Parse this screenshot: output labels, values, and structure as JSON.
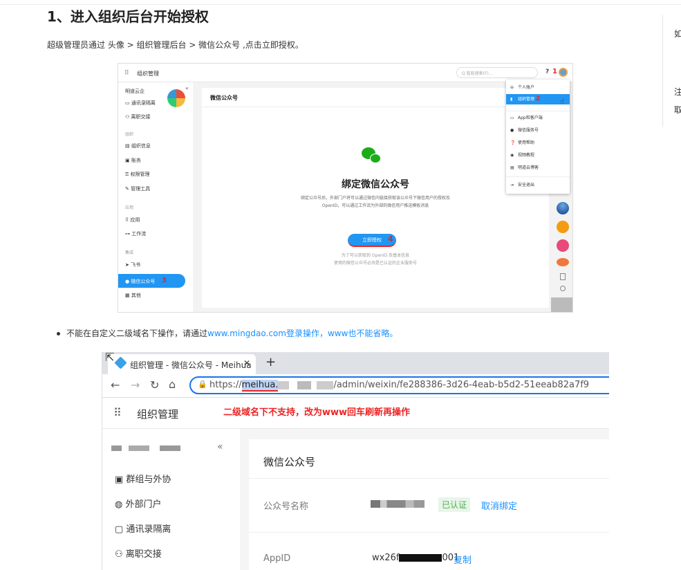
{
  "article": {
    "heading": "1、进入组织后台开始授权",
    "intro": "超级管理员通过 头像 > 组织管理后台 > 微信公众号 ,点击立即授权。",
    "right_panel": [
      "如",
      "注",
      "取"
    ]
  },
  "screenshot1": {
    "app_title": "组织管理",
    "search_placeholder": "Q 智能搜索(F)...",
    "step1": "1",
    "org_name": "明道云企",
    "sidebar": [
      {
        "label": "通讯录隔离",
        "icon": "contacts-icon"
      },
      {
        "label": "离职交接",
        "icon": "handover-icon"
      },
      {
        "group": "组织"
      },
      {
        "label": "组织信息",
        "icon": "org-info-icon"
      },
      {
        "label": "账务",
        "icon": "billing-icon"
      },
      {
        "label": "权限管理",
        "icon": "permission-icon"
      },
      {
        "label": "管理工具",
        "icon": "tools-icon"
      },
      {
        "group": "应用"
      },
      {
        "label": "应用",
        "icon": "apps-icon"
      },
      {
        "label": "工作流",
        "icon": "workflow-icon"
      },
      {
        "group": "集成"
      },
      {
        "label": "飞书",
        "icon": "feishu-icon"
      },
      {
        "label": "微信公众号",
        "icon": "wechat-icon",
        "active": true
      },
      {
        "label": "其他",
        "icon": "other-icon"
      }
    ],
    "step3": "3",
    "panel_title": "微信公众号",
    "bind_title": "绑定微信公众号",
    "bind_desc1": "绑定公众号后，外部门户将可以通过微信内链接获取该公众号下微信用户的授权及",
    "bind_desc2": "OpenID，可以通过工作流为外部的微信用户推送模板消息",
    "authorize_button": "立即授权",
    "step4": "4",
    "note1": "为了可以获取到 OpenID 及基本信息",
    "note2": "使用的微信公众号必须是已认证的企业服务号",
    "dropdown": [
      {
        "label": "个人账户",
        "icon": "user-icon"
      },
      {
        "label": "组织管理",
        "icon": "org-admin-icon",
        "highlight": true
      },
      {
        "label": "App和客户端",
        "icon": "app-icon"
      },
      {
        "label": "微信服务号",
        "icon": "wechat-service-icon"
      },
      {
        "label": "使用帮助",
        "icon": "help-icon"
      },
      {
        "label": "视频教程",
        "icon": "video-icon"
      },
      {
        "label": "明道云博客",
        "icon": "blog-icon"
      },
      {
        "label": "安全退出",
        "icon": "logout-icon"
      }
    ],
    "step2": "2"
  },
  "bullet": {
    "prefix": "不能在自定义二级域名下操作，请通过",
    "link": "www.mingdao.com登录操作，www也不能省略。"
  },
  "screenshot2": {
    "tab_title": "组织管理 - 微信公众号 - Meihua",
    "tab_close": "✕",
    "new_tab": "+",
    "url_scheme": "https://",
    "url_host": "meihua.",
    "url_path": "/admin/weixin/fe288386-3d26-4eab-b5d2-51eeab82a7f9",
    "app_title": "组织管理",
    "annotation": "二级域名下不支持，改为www回车刷新再操作",
    "collapse": "«",
    "sidebar": [
      {
        "label": "群组与外协",
        "icon": "group-icon"
      },
      {
        "label": "外部门户",
        "icon": "portal-icon"
      },
      {
        "label": "通讯录隔离",
        "icon": "contacts-icon"
      },
      {
        "label": "离职交接",
        "icon": "handover-icon"
      }
    ],
    "panel_title": "微信公众号",
    "field1_label": "公众号名称",
    "verified": "已认证",
    "unbind": "取消绑定",
    "field2_label": "AppID",
    "appid_prefix": "wx26f",
    "appid_suffix": "001",
    "copy": "复制"
  },
  "colors": {
    "accent": "#1890ff",
    "annotation": "#e22222",
    "wechat_green": "#1aad19"
  }
}
